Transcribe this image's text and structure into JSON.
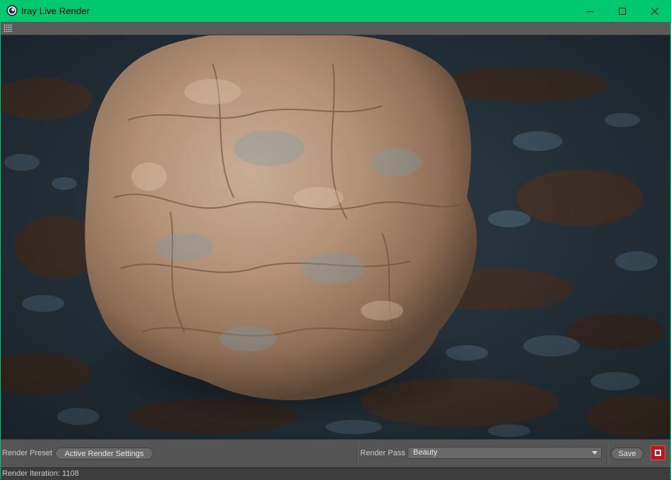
{
  "window": {
    "title": "Iray Live Render"
  },
  "controls": {
    "render_preset_label": "Render Preset",
    "render_preset_button": "Active Render Settings",
    "render_pass_label": "Render Pass",
    "render_pass_value": "Beauty",
    "save_label": "Save"
  },
  "status": {
    "iteration_text": "Render Iteration: 1108"
  },
  "colors": {
    "titlebar": "#00c86e",
    "panel": "#555555",
    "stop_button": "#b21c1c"
  },
  "icons": {
    "app": "cinema4d-icon",
    "minimize": "minimize-icon",
    "maximize": "maximize-icon",
    "close": "close-icon",
    "grip": "grip-icon",
    "stop": "stop-icon",
    "dropdown": "chevron-down-icon"
  }
}
